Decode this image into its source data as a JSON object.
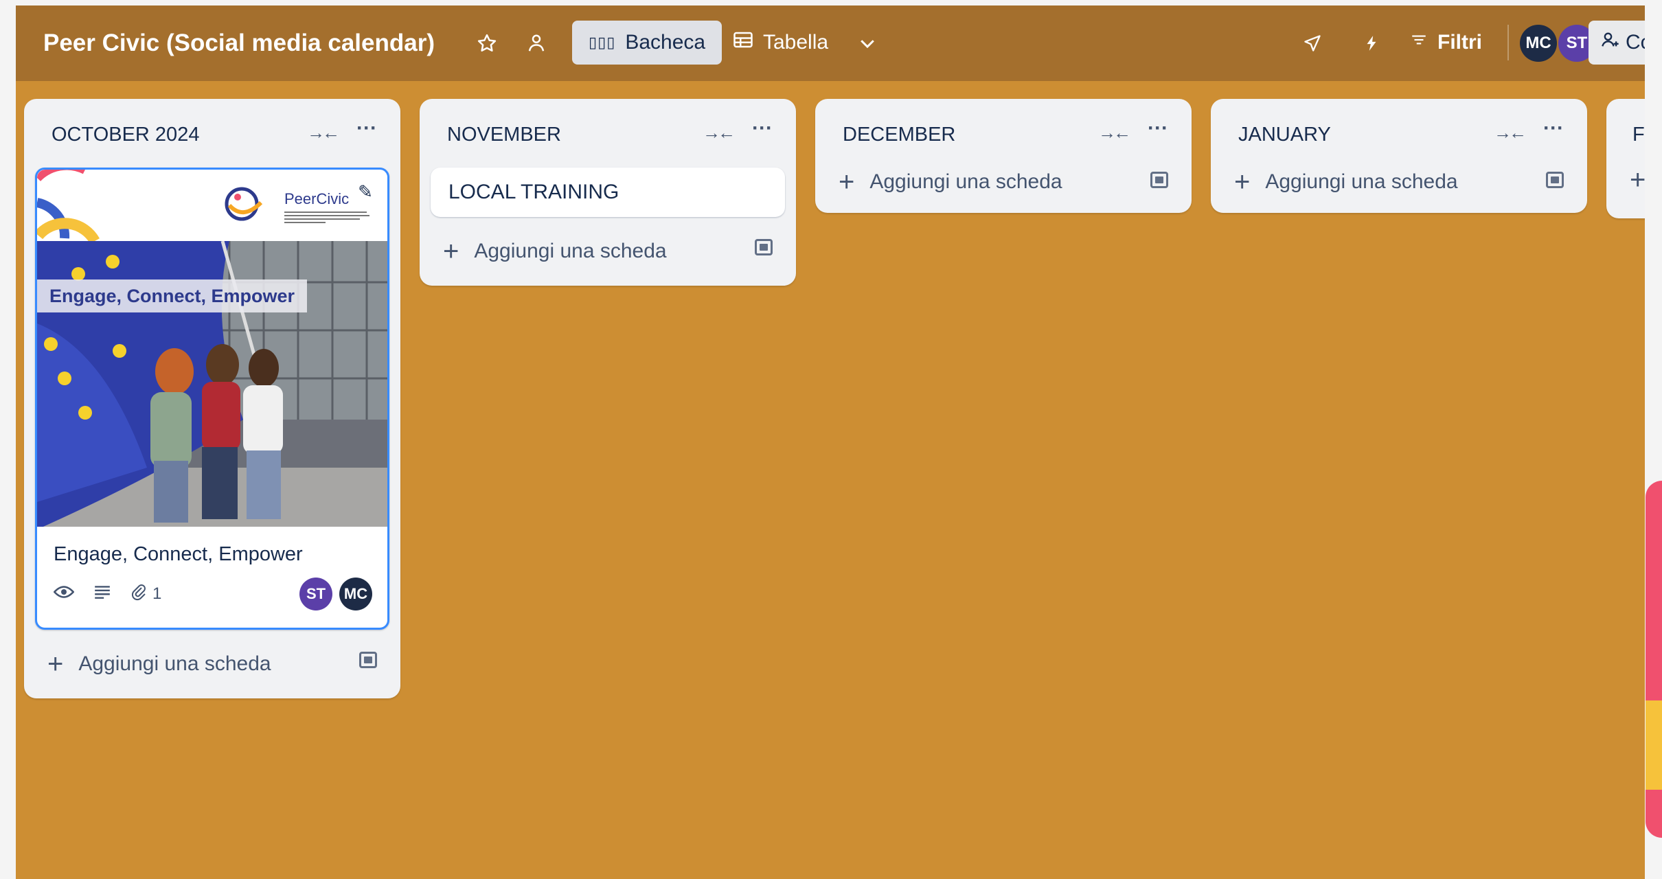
{
  "board": {
    "title": "Peer Civic (Social media calendar)",
    "views": [
      {
        "label": "Bacheca",
        "active": true,
        "icon": "board-icon"
      },
      {
        "label": "Tabella",
        "active": false,
        "icon": "table-icon"
      }
    ],
    "filter_label": "Filtri",
    "share_label": "Co",
    "members": [
      "MC",
      "ST"
    ],
    "colors": {
      "background": "#cd8e33",
      "header": "#a46f2d",
      "accent": "#388bff"
    }
  },
  "lists": [
    {
      "title": "OCTOBER 2024",
      "cards": [
        {
          "title": "Engage, Connect, Empower",
          "cover": {
            "logo_text": "PeerCivic",
            "tagline": "Engage, Connect, Empower"
          },
          "attachments": "1",
          "members": [
            "ST",
            "MC"
          ]
        }
      ],
      "add_label": "Aggiungi una scheda"
    },
    {
      "title": "NOVEMBER",
      "cards": [
        {
          "title": "LOCAL TRAINING"
        }
      ],
      "add_label": "Aggiungi una scheda"
    },
    {
      "title": "DECEMBER",
      "cards": [],
      "add_label": "Aggiungi una scheda"
    },
    {
      "title": "JANUARY",
      "cards": [],
      "add_label": "Aggiungi una scheda"
    },
    {
      "title": "FI",
      "cards": [],
      "add_label": ""
    }
  ]
}
